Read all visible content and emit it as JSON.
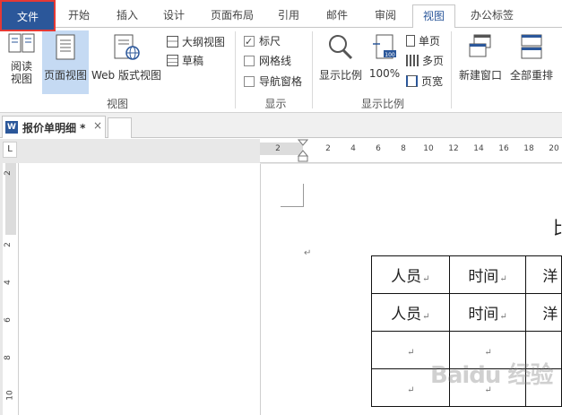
{
  "tabs": [
    {
      "label": "文件"
    },
    {
      "label": "开始"
    },
    {
      "label": "插入"
    },
    {
      "label": "设计"
    },
    {
      "label": "页面布局"
    },
    {
      "label": "引用"
    },
    {
      "label": "邮件"
    },
    {
      "label": "审阅"
    },
    {
      "label": "视图"
    },
    {
      "label": "办公标签"
    }
  ],
  "active_tab": "视图",
  "ribbon": {
    "views_group": {
      "label": "视图",
      "read_mode": "阅读\n视图",
      "print_layout": "页面视图",
      "web_layout": "Web 版式视图",
      "outline": "大纲视图",
      "draft": "草稿"
    },
    "show_group": {
      "label": "显示",
      "ruler": "标尺",
      "ruler_checked": true,
      "gridlines": "网格线",
      "gridlines_checked": false,
      "nav_pane": "导航窗格",
      "nav_pane_checked": false
    },
    "zoom_group": {
      "label": "显示比例",
      "zoom": "显示比例",
      "hundred": "100%",
      "one_page": "单页",
      "multi_page": "多页",
      "page_width": "页宽"
    },
    "window_group": {
      "new_window": "新建窗口",
      "arrange_all": "全部重排"
    }
  },
  "document_tab": {
    "title": "报价单明细 *",
    "close": "×"
  },
  "ruler": {
    "corner": "L",
    "h_ticks": [
      "2",
      "2",
      "4",
      "6",
      "8",
      "10",
      "12",
      "14",
      "16",
      "18",
      "20"
    ],
    "v_ticks": [
      "2",
      "2",
      "4",
      "6",
      "8",
      "10"
    ]
  },
  "doc": {
    "paragraph_mark": "↵",
    "partial_title_char": "比",
    "table": [
      [
        "人员",
        "时间",
        "洋"
      ],
      [
        "人员",
        "时间",
        "洋"
      ],
      [
        "",
        "",
        ""
      ],
      [
        "",
        "",
        ""
      ]
    ]
  },
  "watermark": "Baidu 经验"
}
